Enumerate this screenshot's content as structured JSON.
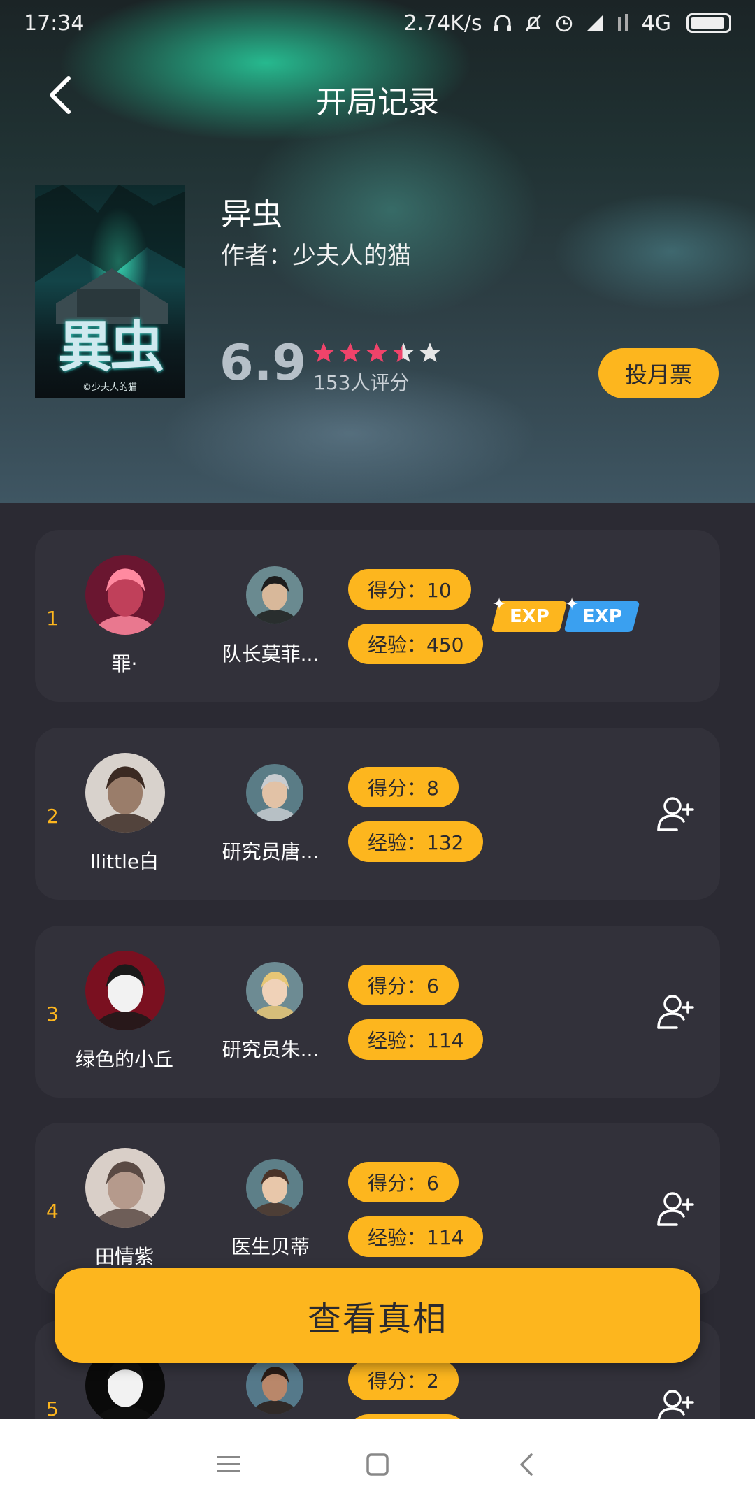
{
  "status_bar": {
    "time": "17:34",
    "speed": "2.74K/s",
    "network": "4G",
    "icons": [
      "headphones-icon",
      "bell-muted-icon",
      "alarm-icon",
      "signal-icon",
      "signal-off-icon",
      "battery-icon"
    ]
  },
  "header": {
    "title": "开局记录",
    "back_icon": "chevron-left-icon"
  },
  "book": {
    "name": "异虫",
    "author": "作者：少夫人的猫",
    "cover_title": "異虫",
    "cover_credit": "©少夫人的猫",
    "score": "6.9",
    "rating_fraction": 0.69,
    "rating_count": "153人评分",
    "vote_label": "投月票"
  },
  "players": [
    {
      "rank": "1",
      "name": "罪·",
      "role": "队长莫菲...",
      "score": "得分：10",
      "exp": "经验：450",
      "exp_badges": [
        "EXP",
        "EXP"
      ],
      "add_friend": false
    },
    {
      "rank": "2",
      "name": "llittle白",
      "role": "研究员唐...",
      "score": "得分：8",
      "exp": "经验：132",
      "add_friend": true
    },
    {
      "rank": "3",
      "name": "绿色的小丘",
      "role": "研究员朱...",
      "score": "得分：6",
      "exp": "经验：114",
      "add_friend": true
    },
    {
      "rank": "4",
      "name": "田情紫",
      "role": "医生贝蒂",
      "score": "得分：6",
      "exp": "经验：114",
      "add_friend": true
    },
    {
      "rank": "5",
      "name": "",
      "role": "",
      "score": "得分：2",
      "exp": "",
      "add_friend": true
    }
  ],
  "cta": {
    "label": "查看真相"
  },
  "colors": {
    "accent": "#fdb61e",
    "background": "#2b2a33",
    "card": "#32313a",
    "star_on": "#f0436a",
    "star_off": "#e6e6e6"
  },
  "navbar": {
    "icons": [
      "menu-icon",
      "home-square-icon",
      "back-triangle-icon"
    ]
  }
}
